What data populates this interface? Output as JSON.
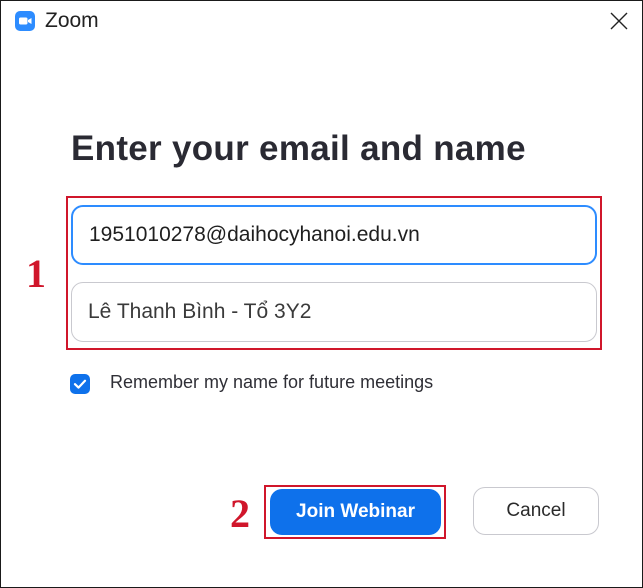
{
  "window": {
    "title": "Zoom",
    "app_icon": "zoom-camera-icon",
    "close_icon": "close-icon"
  },
  "main": {
    "heading": "Enter your email and name",
    "email_field": {
      "value": "1951010278@daihocyhanoi.edu.vn"
    },
    "name_field": {
      "value": "Lê Thanh Bình - Tổ 3Y2"
    },
    "remember": {
      "checked": true,
      "label": "Remember my name for future meetings"
    },
    "join_button_label": "Join Webinar",
    "cancel_button_label": "Cancel"
  },
  "annotations": {
    "marker_1": "1",
    "marker_2": "2"
  },
  "colors": {
    "accent": "#0e71eb",
    "zoom_blue": "#2d8cff",
    "annotation_red": "#d0162b"
  }
}
